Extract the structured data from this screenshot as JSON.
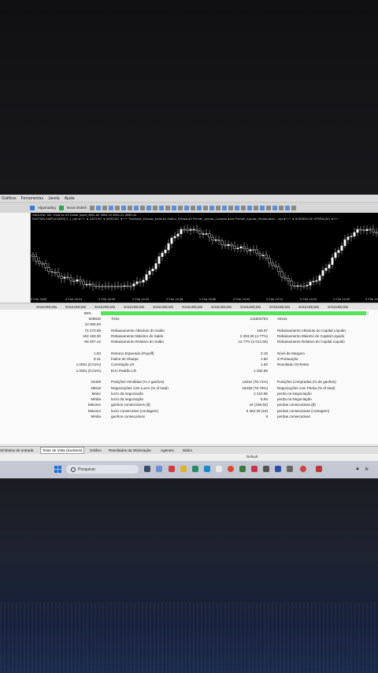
{
  "menu": [
    "Gráficos",
    "Ferramentas",
    "Janela",
    "Ajuda"
  ],
  "toolbar": {
    "algotrading": "Algotrading",
    "new_order": "Nova Ordem"
  },
  "chart": {
    "title": "XAUUSD, M1:  Gold vs US Dollar (spot)  4551.82 4554.10 4551.21 4553.44",
    "subtitle": "FASTWIN-SIMPLES(MT5) 5_1_repl◄+++ ◄ GATILHO ◄ DIREÇÃO ◄+++ Timeframe_Entrada_Inicial◄1 Gráfico_Entrada◄1 Permitir_Apenas_Compras◄true Permitir_Apenas_Vendas◄true ...repl◄+++ ◄ HORÁRIO DE OPERAÇÃO ◄+++",
    "xlabels": [
      "2 Feb 2026",
      "2 Feb 16:24",
      "2 Feb 16:32",
      "2 Feb 16:40",
      "2 Feb 16:48",
      "2 Feb 16:56",
      "2 Feb 19:04",
      "2 Feb 19:12",
      "2 Feb 19:22",
      "2 Feb 19:30",
      "2 Feb 19:44"
    ]
  },
  "chart_tabs": [
    "XAUUSD,M1",
    "XAUUSD,M1",
    "XAUUSD,M1",
    "XAUUSD,M1",
    "XAUUSD,M1",
    "XAUUSD,M1",
    "XAUUSD,M1",
    "XAUUSD,M1",
    "XAUUSD,M1",
    "XAUUSD,M1",
    "XAUUSD,M1"
  ],
  "report": {
    "progress_label": "99%",
    "progress": 0.99,
    "rows": [
      [
        "829816",
        "Ticks",
        "211604793",
        "Ativos"
      ],
      [
        "10 000.00",
        "",
        "",
        ""
      ],
      [
        "74 273.88",
        "Rebaixamento Absoluto do Saldo",
        "155.87",
        "Rebaixamento Absoluto do Capital Líquido"
      ],
      [
        "162 183.30",
        "Rebaixamento Máximo do Saldo",
        "2 263.35 (4.77%)",
        "Rebaixamento Máximo do Capital Líquido"
      ],
      [
        "-88 007.42",
        "Rebaixamento Relativo do Saldo",
        "12.77% (2 012.60)",
        "Rebaixamento Relativo do Capital Líquido"
      ],
      [
        "",
        "",
        "",
        ""
      ],
      [
        "1.83",
        "Retorno Esperado (Payoff)",
        "3.19",
        "Nível de Margem"
      ],
      [
        "8.31",
        "Índice de Sharpe",
        "1.60",
        "Z-Pontuação"
      ],
      [
        "1.0001 (0.01%)",
        "Correlação LR",
        "1.00",
        "Resultado OnTester"
      ],
      [
        "1.0001 (0.01%)",
        "Erro Padrão LR",
        "1 032.56",
        ""
      ],
      [
        "",
        "",
        "",
        ""
      ],
      [
        "23409",
        "Posições Vendidas (% e ganhos)",
        "11810 (78.71%)",
        "Posições Compradas (% de ganhos)"
      ],
      [
        "46818",
        "Negociações com Lucro (% of total)",
        "18438 (78.76%)",
        "Negociações com Perda (% of total)"
      ],
      [
        "Maior",
        "lucro da negociação",
        "2 210.65",
        "perda na Negociação"
      ],
      [
        "Média",
        "lucro da negociação",
        "8.83",
        "perda na Negociação"
      ],
      [
        "Máximo",
        "ganhos consecutivos ($)",
        "44 (196.83)",
        "perdas consecutivas ($)"
      ],
      [
        "Máximo",
        "lucro consecutivo (contagem)",
        "5 364.29 (19)",
        "perdas consecutivas (contagem)"
      ],
      [
        "Média",
        "ganhos consecutivos",
        "9",
        "perdas consecutivas"
      ]
    ]
  },
  "bottom_tabs": [
    "Símbolos de entrada",
    "Teste de Volta (backtest)",
    "Gráfico",
    "Resultados da Otimização",
    "Agentes",
    "Diário"
  ],
  "status": "Default",
  "taskbar": {
    "search_placeholder": "Pesquisar"
  }
}
